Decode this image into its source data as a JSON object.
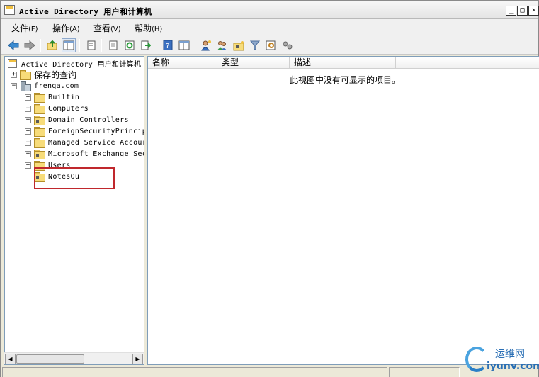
{
  "window": {
    "title": "Active Directory 用户和计算机"
  },
  "titlebar_buttons": [
    "_",
    "□",
    "×"
  ],
  "menu": [
    {
      "label": "文件",
      "accel": "(F)"
    },
    {
      "label": "操作",
      "accel": "(A)"
    },
    {
      "label": "查看",
      "accel": "(V)"
    },
    {
      "label": "帮助",
      "accel": "(H)"
    }
  ],
  "toolbar_icons": [
    "back-icon",
    "forward-icon",
    "up-icon",
    "show-tree-icon",
    "properties-icon",
    "export-icon",
    "refresh-icon",
    "export-list-icon",
    "help-icon",
    "console-icon",
    "new-user-icon",
    "new-group-icon",
    "new-ou-icon",
    "filter-icon",
    "find-icon",
    "delegate-icon"
  ],
  "tree": {
    "root_label": "Active Directory 用户和计算机",
    "saved_queries": "保存的查询",
    "domain": "frenqa.com",
    "children": [
      {
        "label": "Builtin",
        "expandable": true
      },
      {
        "label": "Computers",
        "expandable": true
      },
      {
        "label": "Domain Controllers",
        "expandable": true
      },
      {
        "label": "ForeignSecurityPrincip",
        "expandable": true
      },
      {
        "label": "Managed Service Accour",
        "expandable": true
      },
      {
        "label": "Microsoft Exchange Sec",
        "expandable": true
      },
      {
        "label": "Users",
        "expandable": true
      },
      {
        "label": "NotesOu",
        "expandable": false
      }
    ],
    "highlight_color": "#c0282d"
  },
  "list": {
    "columns": [
      "名称",
      "类型",
      "描述"
    ],
    "empty_message": "此视图中没有可显示的项目。"
  },
  "watermark": {
    "cn": "运维网",
    "en": "iyunv.com"
  }
}
